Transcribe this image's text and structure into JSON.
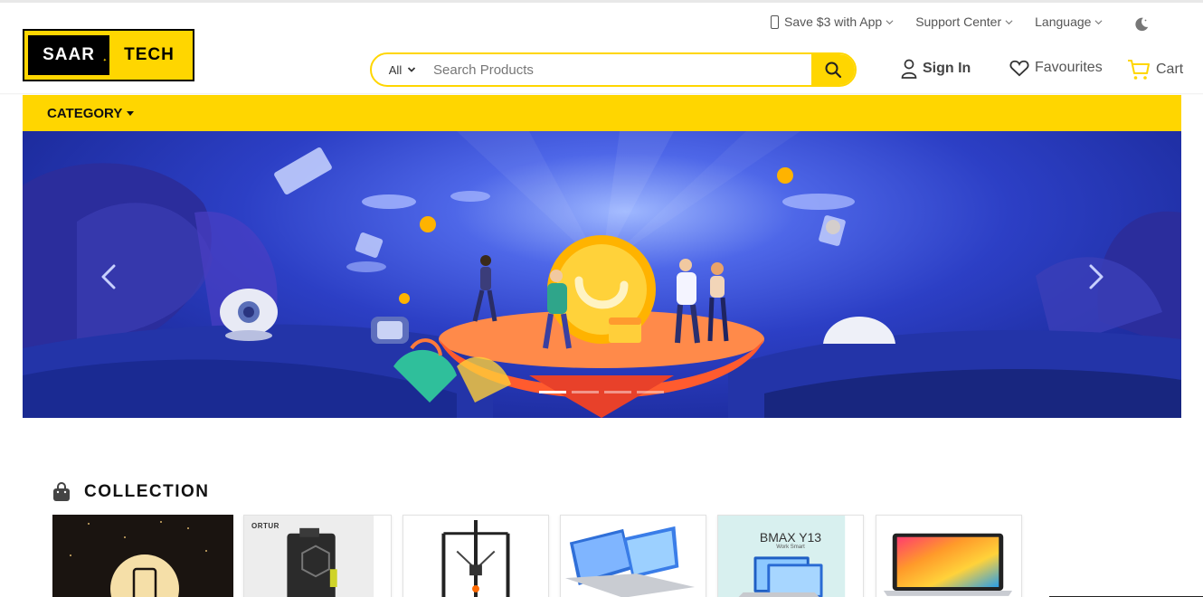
{
  "utility_bar": {
    "app_promo": "Save $3 with App",
    "support": "Support Center",
    "language": "Language"
  },
  "logo": {
    "left": "SAAR",
    "right": "TECH"
  },
  "search": {
    "category": "All",
    "placeholder": "Search Products"
  },
  "header": {
    "sign_in": "Sign In",
    "favourites": "Favourites",
    "cart": "Cart"
  },
  "category_bar": {
    "label": "CATEGORY"
  },
  "banner": {
    "slide_count": 4,
    "active_slide": 1
  },
  "collection": {
    "title": "COLLECTION",
    "items": [
      {
        "name": "phone-deal-card"
      },
      {
        "name": "laser-engraver-card",
        "brand": "ORTUR"
      },
      {
        "name": "3d-printer-card"
      },
      {
        "name": "convertible-laptop-card"
      },
      {
        "name": "bmax-laptop-card",
        "brand": "BMAX Y13",
        "tagline": "Work Smart"
      },
      {
        "name": "macbook-card"
      }
    ]
  },
  "colors": {
    "accent": "#FFD600",
    "text": "#333333",
    "banner_blue": "#2c3fc5"
  }
}
